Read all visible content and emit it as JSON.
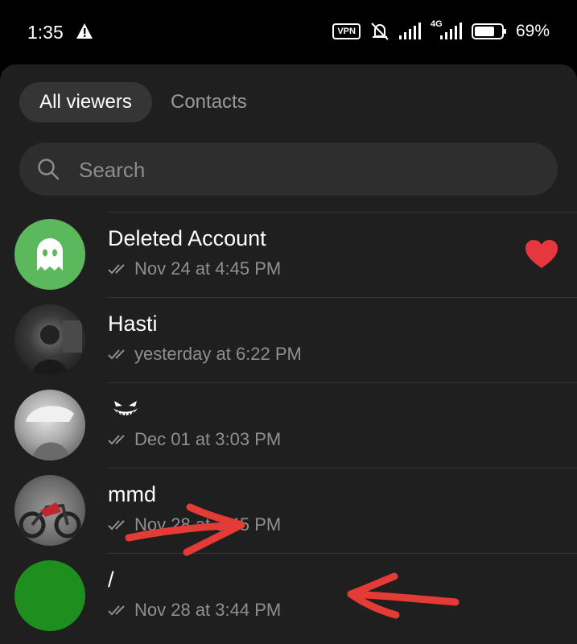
{
  "status_bar": {
    "time": "1:35",
    "vpn_label": "VPN",
    "network_label": "4G",
    "battery_percent": "69%"
  },
  "tabs": [
    {
      "label": "All viewers",
      "selected": true
    },
    {
      "label": "Contacts",
      "selected": false
    }
  ],
  "search": {
    "placeholder": "Search",
    "value": ""
  },
  "viewers": [
    {
      "name": "Deleted Account",
      "timestamp": "Nov 24 at 4:45 PM",
      "avatar": "ghost-icon",
      "avatar_color": "#5cb85c",
      "reaction": "heart-icon"
    },
    {
      "name": "Hasti",
      "timestamp": "yesterday at 6:22 PM",
      "avatar": "photo",
      "avatar_color": "#3a3a3a"
    },
    {
      "name": "",
      "timestamp": "Dec 01 at 3:03 PM",
      "avatar": "photo",
      "avatar_color": "#9a9a9a",
      "name_icon": "grinning-face-icon"
    },
    {
      "name": "mmd",
      "timestamp": "Nov 28 at 3:45 PM",
      "avatar": "photo",
      "avatar_color": "#7a7a7a"
    },
    {
      "name": "/",
      "timestamp": "Nov 28 at 3:44 PM",
      "avatar": "solid",
      "avatar_color": "#1e8f1e"
    }
  ],
  "colors": {
    "background": "#1f1f1f",
    "heart": "#e8363f",
    "annotation": "#e53b36"
  }
}
